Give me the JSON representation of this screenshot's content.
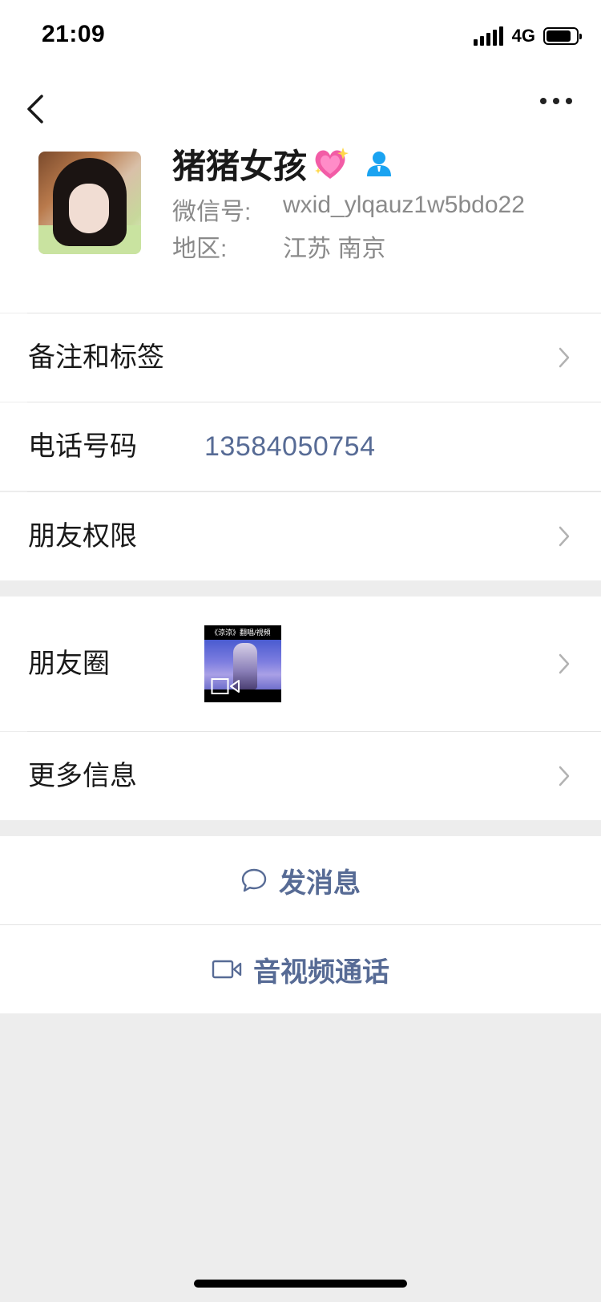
{
  "status_bar": {
    "time": "21:09",
    "network": "4G"
  },
  "header": {
    "back_icon": "chevron-left-icon",
    "more_icon": "ellipsis-icon"
  },
  "profile": {
    "name": "猪猪女孩",
    "name_emoji": "sparkling-heart-icon",
    "contact_icon": "person-icon",
    "wechat_id_label": "微信号:",
    "wechat_id": "wxid_ylqauz1w5bdo22",
    "region_label": "地区:",
    "region": "江苏 南京"
  },
  "rows": {
    "remarks_tags": "备注和标签",
    "phone_label": "电话号码",
    "phone_value": "13584050754",
    "friend_permissions": "朋友权限",
    "moments": "朋友圈",
    "moments_thumb_caption": "《涼涼》翻唱/視頻",
    "more_info": "更多信息"
  },
  "actions": {
    "send_message": "发消息",
    "av_call": "音视频通话"
  },
  "colors": {
    "link_blue": "#576b95",
    "background": "#ededed",
    "card": "#ffffff",
    "contact_icon_blue": "#1aa3f1"
  }
}
